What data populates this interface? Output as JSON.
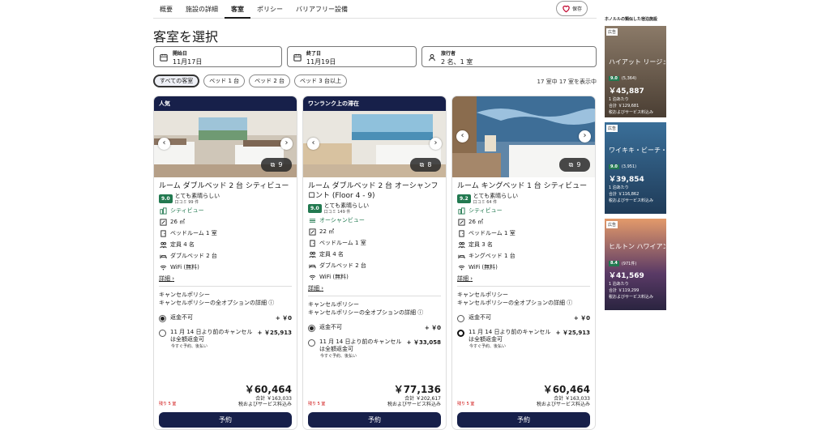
{
  "nav": {
    "tabs": [
      "概要",
      "施設の詳細",
      "客室",
      "ポリシー",
      "バリアフリー設備"
    ],
    "save": "保存"
  },
  "title": "客室を選択",
  "search": {
    "start_label": "開始日",
    "start_value": "11月17日",
    "end_label": "終了日",
    "end_value": "11月19日",
    "guests_label": "旅行者",
    "guests_value": "2 名、1 室"
  },
  "filters": [
    "すべての客室",
    "ベッド 1 台",
    "ベッド 2 台",
    "ベッド 3 台以上"
  ],
  "count": "17 室中 17 室を表示中",
  "rooms": [
    {
      "badge": "人気",
      "photos": "9",
      "name": "ルーム ダブルベッド 2 台 シティビュー",
      "score": "9.0",
      "rating": "とても素晴らしい",
      "reviews": "口コミ 99 件",
      "features": [
        "シティビュー",
        "26 ㎡",
        "ベッドルーム 1 室",
        "定員 4 名",
        "ダブルベッド 2 台",
        "WiFi (無料)"
      ],
      "detail": "詳細",
      "policy": "キャンセルポリシー",
      "policy_link": "キャンセルポリシーの全オプションの詳細",
      "opt1": "返金不可",
      "opt1_price": "+ ￥0",
      "opt2": "11 月 14 日より前のキャンセルは全額返金可",
      "opt2_price": "+ ￥25,913",
      "opt2_sub": "今すぐ予約、後払い",
      "price": "￥60,464",
      "total": "合計 ￥163,033",
      "tax": "税およびサービス料込み",
      "left": "残り 5 室",
      "book": "予約"
    },
    {
      "badge": "ワンランク上の滞在",
      "photos": "8",
      "name": "ルーム ダブルベッド 2 台 オーシャンフロント (Floor 4 - 9)",
      "score": "9.0",
      "rating": "とても素晴らしい",
      "reviews": "口コミ 149 件",
      "features": [
        "オーシャンビュー",
        "22 ㎡",
        "ベッドルーム 1 室",
        "定員 4 名",
        "ダブルベッド 2 台",
        "WiFi (無料)"
      ],
      "detail": "詳細",
      "policy": "キャンセルポリシー",
      "policy_link": "キャンセルポリシーの全オプションの詳細",
      "opt1": "返金不可",
      "opt1_price": "+ ￥0",
      "opt2": "11 月 14 日より前のキャンセルは全額返金可",
      "opt2_price": "+ ￥33,058",
      "opt2_sub": "今すぐ予約、後払い",
      "price": "￥77,136",
      "total": "合計 ￥202,617",
      "tax": "税およびサービス料込み",
      "left": "残り 5 室",
      "book": "予約"
    },
    {
      "badge": "",
      "photos": "9",
      "name": "ルーム キングベッド 1 台 シティビュー",
      "score": "9.2",
      "rating": "とても素晴らしい",
      "reviews": "口コミ 64 件",
      "features": [
        "シティビュー",
        "26 ㎡",
        "ベッドルーム 1 室",
        "定員 3 名",
        "キングベッド 1 台",
        "WiFi (無料)"
      ],
      "detail": "詳細",
      "policy": "キャンセルポリシー",
      "policy_link": "キャンセルポリシーの全オプションの詳細",
      "opt1": "返金不可",
      "opt1_price": "+ ￥0",
      "opt2": "11 月 14 日より前のキャンセルは全額返金可",
      "opt2_price": "+ ￥25,913",
      "opt2_sub": "今すぐ予約、後払い",
      "price": "￥60,464",
      "total": "合計 ￥163,033",
      "tax": "税およびサービス料込み",
      "left": "残り 5 室",
      "book": "予約"
    }
  ],
  "ads": {
    "title": "ホノルルの類似した宿泊施設",
    "items": [
      {
        "tag": "広告",
        "name": "ハイアット リージェンシー ワイキキ",
        "score": "9.0",
        "reviews": "(5,364)",
        "price": "￥45,887",
        "per": "1 泊あたり",
        "total": "合計 ￥129,681",
        "tax": "税およびサービス料込み"
      },
      {
        "tag": "広告",
        "name": "ワイキキ・ビーチ・マリオット・リゾート",
        "score": "9.0",
        "reviews": "(3,951)",
        "price": "￥39,854",
        "per": "1 泊あたり",
        "total": "合計 ￥116,862",
        "tax": "税およびサービス料込み"
      },
      {
        "tag": "広告",
        "name": "ヒルトン ハワイアン ビレッジ ワイキキ",
        "score": "8.4",
        "reviews": "(971件)",
        "price": "￥41,569",
        "per": "1 泊あたり",
        "total": "合計 ￥119,299",
        "tax": "税およびサービス料込み"
      }
    ]
  },
  "colors": {
    "primary": "#17204a",
    "rating": "#227950",
    "alert": "#cc0000"
  }
}
